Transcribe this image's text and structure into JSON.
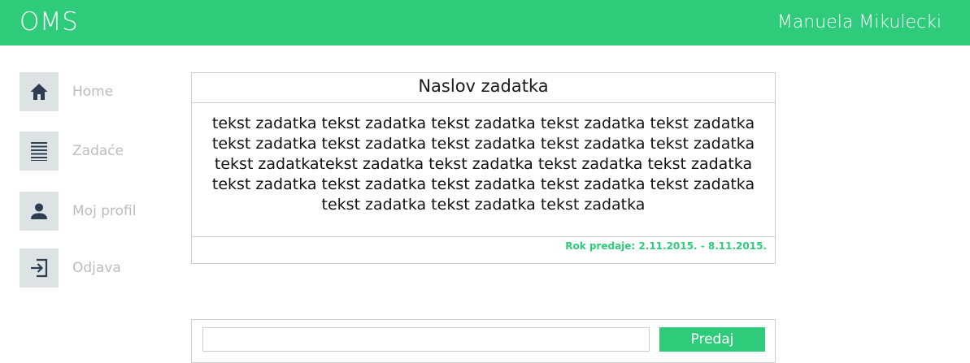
{
  "header": {
    "app_title": "OMS",
    "user_name": "Manuela Mikulecki"
  },
  "sidebar": {
    "items": [
      {
        "label": "Home",
        "icon": "home-icon"
      },
      {
        "label": "Zadaće",
        "icon": "list-icon"
      },
      {
        "label": "Moj profil",
        "icon": "user-icon"
      },
      {
        "label": "Odjava",
        "icon": "logout-icon"
      }
    ]
  },
  "task": {
    "title": "Naslov zadatka",
    "body_lines": [
      "tekst zadatka tekst zadatka tekst zadatka tekst zadatka tekst zadatka",
      "tekst zadatka tekst zadatka tekst zadatka tekst zadatka tekst zadatka",
      "tekst zadatkatekst zadatka tekst zadatka tekst zadatka tekst zadatka",
      "tekst zadatka tekst zadatka tekst zadatka tekst zadatka tekst zadatka",
      "tekst zadatka tekst zadatka tekst zadatka"
    ],
    "deadline": "Rok predaje: 2.11.2015. - 8.11.2015."
  },
  "submission": {
    "input_value": "",
    "input_placeholder": "",
    "submit_label": "Predaj"
  },
  "colors": {
    "accent": "#2ecc7a",
    "icon_bg": "#dde2e4",
    "icon_fg": "#2c3e50",
    "muted_text": "#b9bec1",
    "border": "#c9cfd2"
  }
}
